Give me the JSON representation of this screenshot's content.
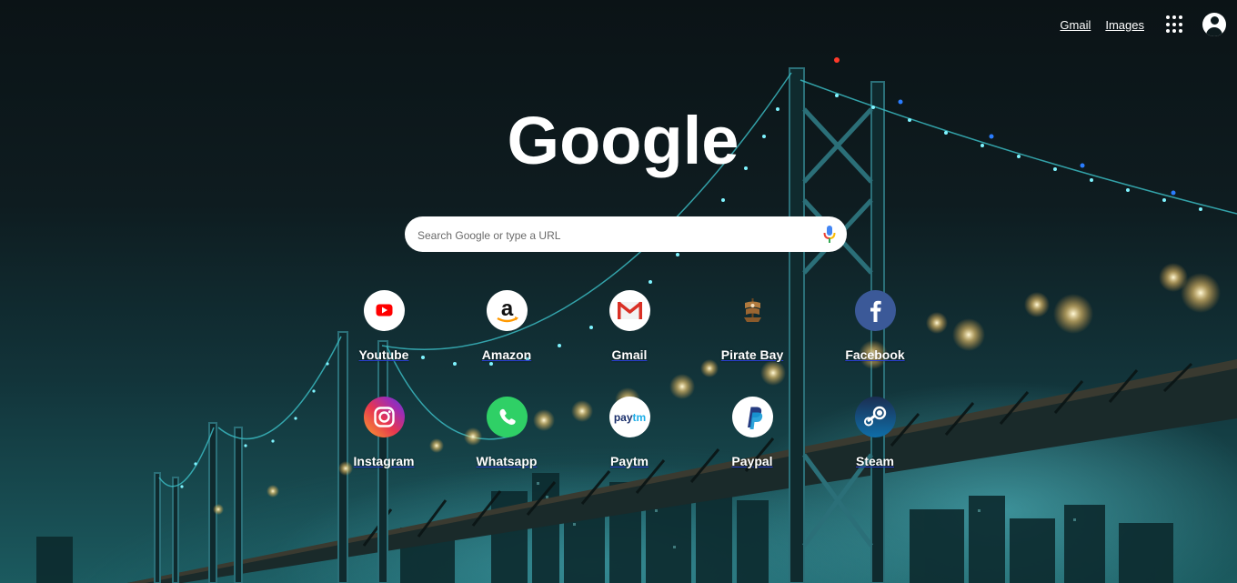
{
  "header": {
    "gmail_label": "Gmail",
    "images_label": "Images"
  },
  "logo": {
    "text": "Google"
  },
  "search": {
    "placeholder": "Search Google or type a URL"
  },
  "shortcuts": [
    {
      "label": "Youtube"
    },
    {
      "label": "Amazon"
    },
    {
      "label": "Gmail"
    },
    {
      "label": "Pirate Bay"
    },
    {
      "label": "Facebook"
    },
    {
      "label": "Instagram"
    },
    {
      "label": "Whatsapp"
    },
    {
      "label": "Paytm"
    },
    {
      "label": "Paypal"
    },
    {
      "label": "Steam"
    }
  ]
}
